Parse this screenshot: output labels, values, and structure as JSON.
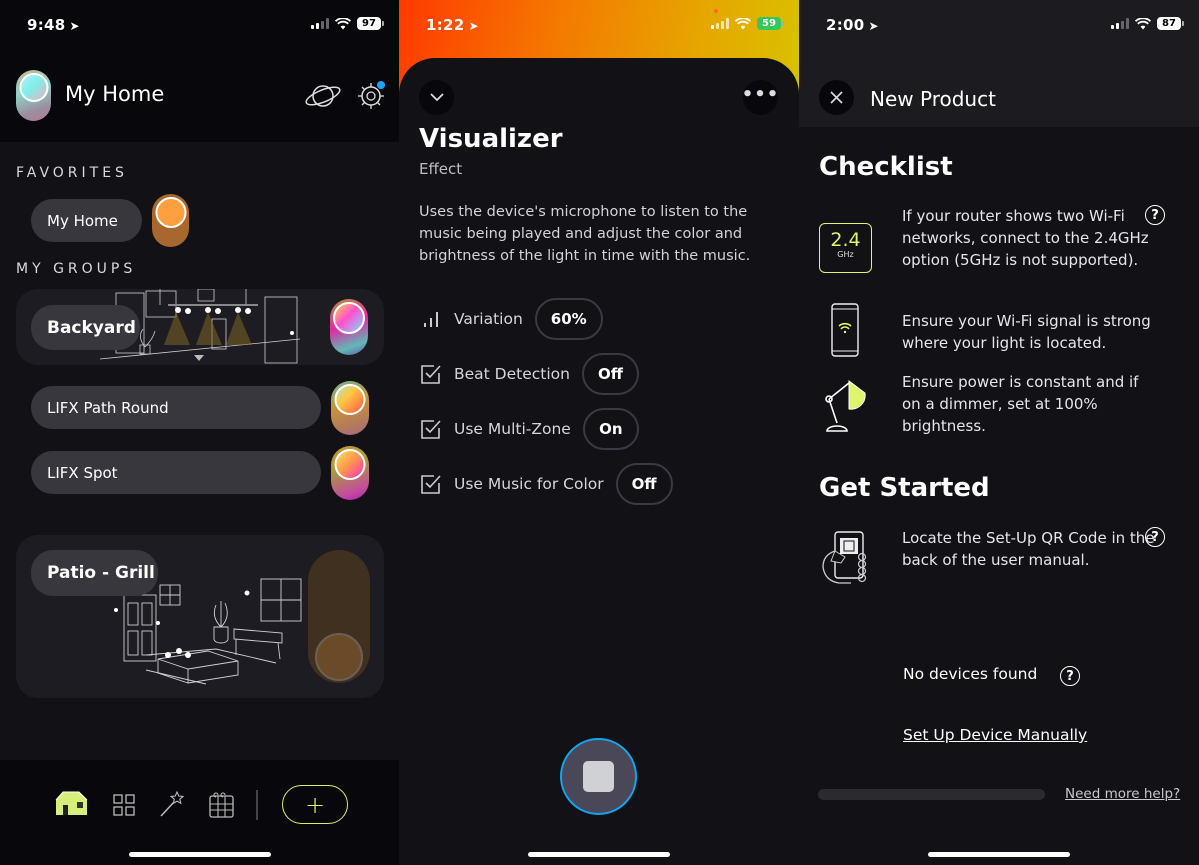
{
  "panel1": {
    "status": {
      "time": "9:48",
      "battery": "97",
      "signal_bars": 2
    },
    "header": {
      "title": "My Home",
      "planet_icon": "planet-icon",
      "settings_icon": "gear-icon",
      "settings_badge_color": "#1aa3ff"
    },
    "favorites": {
      "label": "FAVORITES",
      "items": [
        {
          "name": "My Home",
          "power": "on",
          "color": "#ff9f40"
        }
      ]
    },
    "groups": {
      "label": "MY GROUPS",
      "items": [
        {
          "name": "Backyard",
          "type": "group",
          "power": "on"
        },
        {
          "name": "LIFX Path Round",
          "type": "device",
          "power": "on"
        },
        {
          "name": "LIFX Spot",
          "type": "device",
          "power": "on"
        },
        {
          "name": "Patio - Grill",
          "type": "group",
          "power": "off"
        }
      ]
    },
    "nav": {
      "items": [
        {
          "name": "home",
          "icon": "house-icon",
          "active": true
        },
        {
          "name": "devices",
          "icon": "grid-icon",
          "active": false
        },
        {
          "name": "effects",
          "icon": "magic-wand-icon",
          "active": false
        },
        {
          "name": "schedules",
          "icon": "calendar-icon",
          "active": false
        }
      ],
      "add_label": "+",
      "accent": "#dff56c"
    }
  },
  "panel2": {
    "status": {
      "time": "1:22",
      "battery": "59",
      "charging": true
    },
    "title": "Visualizer",
    "subtitle": "Effect",
    "description": "Uses the device's microphone to listen to the music being played and adjust the color and brightness of the light in time with the music.",
    "options": [
      {
        "label": "Variation",
        "value": "60%",
        "icon": "bars-icon"
      },
      {
        "label": "Beat Detection",
        "value": "Off",
        "icon": "checkbox-icon"
      },
      {
        "label": "Use Multi-Zone",
        "value": "On",
        "icon": "checkbox-icon"
      },
      {
        "label": "Use Music for Color",
        "value": "Off",
        "icon": "checkbox-icon"
      }
    ],
    "stop_button_accent": "#12a5f0"
  },
  "panel3": {
    "status": {
      "time": "2:00",
      "battery": "87"
    },
    "title": "New Product",
    "checklist": {
      "heading": "Checklist",
      "items": [
        {
          "text": "If your router shows two Wi-Fi networks, connect to the 2.4GHz option (5GHz is not supported).",
          "icon": "wifi-band-icon",
          "band_value": "2.4",
          "band_unit": "GHz",
          "has_help": true
        },
        {
          "text": "Ensure your Wi-Fi signal is strong where your light is located.",
          "icon": "phone-wifi-icon",
          "has_help": false
        },
        {
          "text": "Ensure power is constant and if on a dimmer, set at 100% brightness.",
          "icon": "desk-lamp-icon",
          "has_help": false
        }
      ]
    },
    "get_started": {
      "heading": "Get Started",
      "items": [
        {
          "text": "Locate the Set-Up QR Code in the back of the user manual.",
          "icon": "qr-phone-icon",
          "has_help": true
        }
      ]
    },
    "status_text": "No devices found",
    "manual_link": "Set Up Device Manually",
    "help_link": "Need more help?",
    "accent": "#dff56c"
  }
}
